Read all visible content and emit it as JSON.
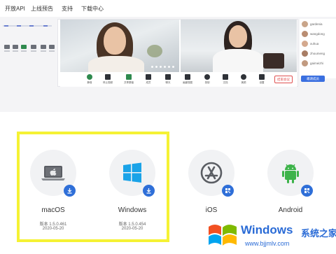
{
  "nav": {
    "items": [
      "开放API",
      "上线预告",
      "支持",
      "下载中心"
    ]
  },
  "meeting_preview": {
    "toolbar": {
      "tools": [
        {
          "label": "静音",
          "icon": "mic-icon"
        },
        {
          "label": "停止视频",
          "icon": "video-icon"
        },
        {
          "label": "共享屏幕",
          "icon": "screen-share-icon"
        },
        {
          "label": "成员",
          "icon": "members-icon"
        },
        {
          "label": "聊天",
          "icon": "chat-icon"
        },
        {
          "label": "画廊视图",
          "icon": "gallery-icon"
        },
        {
          "label": "录制",
          "icon": "record-icon"
        },
        {
          "label": "文档",
          "icon": "doc-icon"
        },
        {
          "label": "美颜",
          "icon": "beauty-icon"
        },
        {
          "label": "设置",
          "icon": "settings-icon"
        }
      ],
      "end_label": "结束会议"
    },
    "participants": [
      "gardenia",
      "wangdong",
      "xuhua",
      "zhoumeng",
      "gaimeizhi"
    ],
    "invite_label": "邀请成员"
  },
  "downloads": {
    "accent_color": "#2f6fd8",
    "highlight_color": "#f5f234",
    "platforms": [
      {
        "name": "macOS",
        "version": "版本 1.5.0.461",
        "date": "2020-05-20",
        "icon": "laptop-apple-icon",
        "badge": "download-icon"
      },
      {
        "name": "Windows",
        "version": "版本 1.5.0.454",
        "date": "2020-05-20",
        "icon": "windows-logo-icon",
        "badge": "download-icon"
      },
      {
        "name": "iOS",
        "version": "",
        "date": "",
        "icon": "app-store-icon",
        "badge": "qr-code-icon"
      },
      {
        "name": "Android",
        "version": "",
        "date": "",
        "icon": "android-icon",
        "badge": "qr-code-icon"
      }
    ]
  },
  "watermark": {
    "title": "Windows",
    "subtitle": "系统之家",
    "url": "www.bjjmlv.com"
  }
}
